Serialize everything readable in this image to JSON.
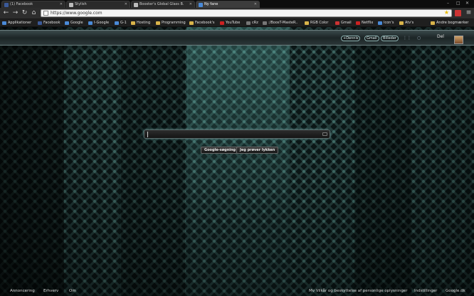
{
  "browser": {
    "tabs": [
      {
        "title": "(1) Facebook",
        "favicon_color": "#3b5998"
      },
      {
        "title": "Stylish",
        "favicon_color": "#bbbbbb"
      },
      {
        "title": "Booster's Global Glass B.",
        "favicon_color": "#bbbbbb"
      },
      {
        "title": "Ny fane",
        "favicon_color": "#4a8ad8"
      }
    ],
    "address": "https://www.google.com",
    "bookmarks": [
      {
        "label": "Applikationer",
        "color": "#4a8ad8"
      },
      {
        "label": "Facebook",
        "color": "#3b5998"
      },
      {
        "label": "Google",
        "color": "#4a8ad8"
      },
      {
        "label": "I-Google",
        "color": "#4a8ad8"
      },
      {
        "label": "G-1",
        "color": "#4a8ad8"
      },
      {
        "label": "Hosting",
        "color": "#d9b44a"
      },
      {
        "label": "Programming",
        "color": "#d9b44a"
      },
      {
        "label": "Facebook's",
        "color": "#d9b44a"
      },
      {
        "label": "YouTube",
        "color": "#cc2222"
      },
      {
        "label": "cRz",
        "color": "#777777"
      },
      {
        "label": ":/BoosT-MasteR..",
        "color": "#777777"
      },
      {
        "label": "RGB Color",
        "color": "#d9b44a"
      },
      {
        "label": "Gmail",
        "color": "#cc3333"
      },
      {
        "label": "Netflix",
        "color": "#cc2222"
      },
      {
        "label": "Icon's",
        "color": "#4a8ad8"
      },
      {
        "label": "Atv's",
        "color": "#d9b44a"
      },
      {
        "label": "Andre bogmærker",
        "color": "#d9b44a"
      }
    ]
  },
  "gbar": {
    "plus": "+Dennis",
    "gmail": "Gmail",
    "images": "Billeder",
    "user": "Del"
  },
  "search": {
    "placeholder": "",
    "button_search": "Google-søgning",
    "button_lucky": "Jeg prøver lykken"
  },
  "footer": {
    "ads": "Annoncering",
    "business": "Erhverv",
    "about": "Om",
    "privacy": "Mv Vilkår og beskyttelse af personlige oplysninger",
    "settings": "Indstillinger",
    "domain": "Google.dk"
  },
  "colors": {
    "accent": "#8fd9d9",
    "background": "#0b1616"
  }
}
